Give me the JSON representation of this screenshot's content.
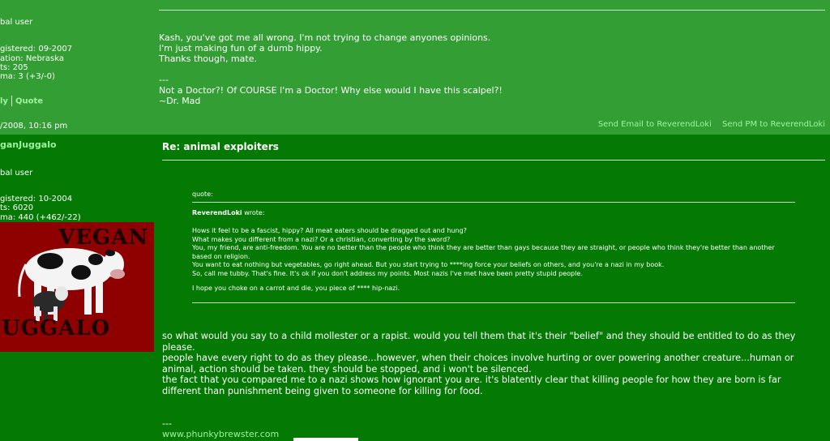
{
  "post1": {
    "profile": {
      "rank": "bal user",
      "registered": "gistered: 09-2007",
      "location": "ation: Nebraska",
      "posts": "ts: 205",
      "karma": "ma: 3 (+3/-0)"
    },
    "actions": {
      "reply": "ly",
      "quote": "Quote"
    },
    "date": "/2008, 10:16 pm",
    "body_lines": [
      "Kash, you've got me all wrong. I'm not trying to change anyones opinions.",
      "I'm just making fun of a dumb hippy.",
      "Thanks though, mate."
    ],
    "sig_lines": [
      "---",
      "Not a Doctor?! Of COURSE I'm a Doctor! Why else would I have this scalpel?!",
      "~Dr. Mad"
    ],
    "links": {
      "send_email": "Send Email to ReverendLoki",
      "send_pm": "Send PM to ReverendLoki"
    }
  },
  "post2": {
    "username": "ganJuggalo",
    "profile": {
      "rank": "bal user",
      "registered": "gistered: 10-2004",
      "posts": "ts: 6020",
      "karma": "ma: 440 (+462/-22)"
    },
    "avatar": {
      "word_top": "VEGAN",
      "word_bottom": "UGGALO"
    },
    "title": "Re: animal exploiters",
    "quote": {
      "label": "quote:",
      "author": "ReverendLoki",
      "wrote": " wrote:",
      "lines": [
        "Hows it feel to be a fascist, hippy? All meat eaters should be dragged out and hung?",
        "What makes you different from a nazi? Or a christian, converting by the sword?",
        "You, my friend, are anti-freedom. You are no better than the people who think they are better than gays because they are straight, or people who think they're better than another based on religion.",
        "You want to eat nothing but vegetables, go right ahead. But you start trying to ****ing force your beliefs on others, and you're a nazi in my book.",
        "So, call me tubby. That's fine. It's ok if you don't address my points. Most nazis I've met have been pretty stupid people.",
        "I hope you choke on a carrot and die, you piece of **** hip-nazi."
      ]
    },
    "body_paragraphs": [
      "so what would you say to a child mollester or a rapist. would you tell them that it's their \"belief\" and they should be entitled to do as they please.",
      "people have every right to do as they please...however, when their choices involve hurting or over powering another creature...human or animal, action should be taken. they should be stopped, and i won't be silenced.",
      "the fact that you compared me to a nazi shows how ignorant you are. it's blatently clear that killing people for how they are born is far different than punishment being given to someone for killing for food."
    ],
    "sig_dash": "---",
    "sig_link": "www.phunkybrewster.com"
  },
  "colors": {
    "post1_bg": "#339e33",
    "post2_bg": "#047a04",
    "link": "#9ef59e",
    "avatar_bg": "#8f0000"
  }
}
